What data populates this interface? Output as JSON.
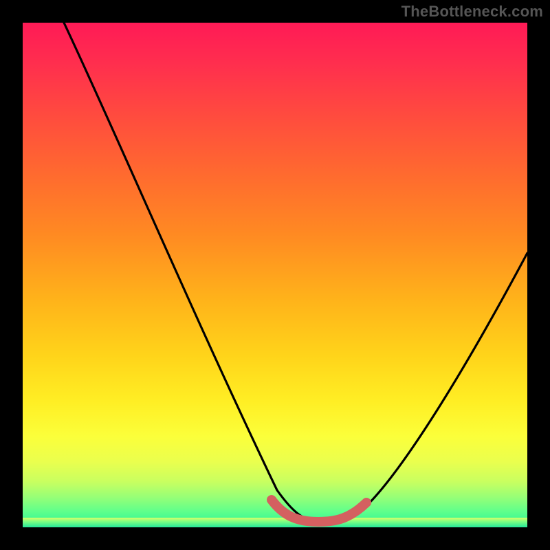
{
  "watermark": "TheBottleneck.com",
  "chart_data": {
    "type": "line",
    "title": "",
    "xlabel": "",
    "ylabel": "",
    "xlim": [
      0,
      100
    ],
    "ylim": [
      0,
      100
    ],
    "grid": false,
    "legend": false,
    "curve_x": [
      8,
      15,
      25,
      35,
      45,
      50,
      55,
      60,
      62,
      65,
      70,
      80,
      90,
      100
    ],
    "curve_y": [
      100,
      85,
      65,
      45,
      25,
      15,
      7,
      2,
      1,
      2,
      8,
      22,
      38,
      55
    ],
    "highlight": {
      "x": [
        50,
        55,
        60,
        62,
        65,
        68
      ],
      "y": [
        5,
        2,
        1,
        1,
        2,
        5
      ]
    },
    "gradient_stops": [
      {
        "pos": 0,
        "color": "#ff1a56"
      },
      {
        "pos": 50,
        "color": "#ffb31a"
      },
      {
        "pos": 80,
        "color": "#fbff3a"
      },
      {
        "pos": 100,
        "color": "#29f19a"
      }
    ]
  }
}
